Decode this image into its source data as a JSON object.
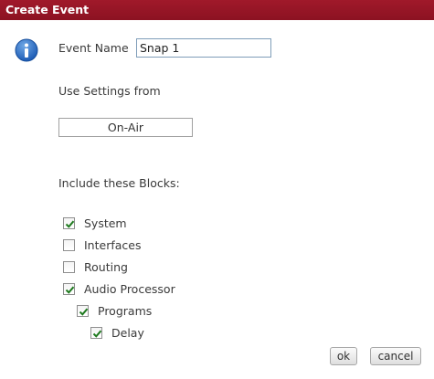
{
  "dialog": {
    "title": "Create Event",
    "icon": "info-icon",
    "accent_color": "#931627"
  },
  "event_name": {
    "label": "Event Name",
    "value": "Snap 1"
  },
  "settings": {
    "label": "Use Settings from",
    "selected": "On-Air"
  },
  "blocks": {
    "label": "Include these Blocks:",
    "items": [
      {
        "label": "System",
        "checked": true,
        "indent": 0
      },
      {
        "label": "Interfaces",
        "checked": false,
        "indent": 0
      },
      {
        "label": "Routing",
        "checked": false,
        "indent": 0
      },
      {
        "label": "Audio Processor",
        "checked": true,
        "indent": 0
      },
      {
        "label": "Programs",
        "checked": true,
        "indent": 1
      },
      {
        "label": "Delay",
        "checked": true,
        "indent": 2
      }
    ]
  },
  "buttons": {
    "ok": "ok",
    "cancel": "cancel"
  }
}
